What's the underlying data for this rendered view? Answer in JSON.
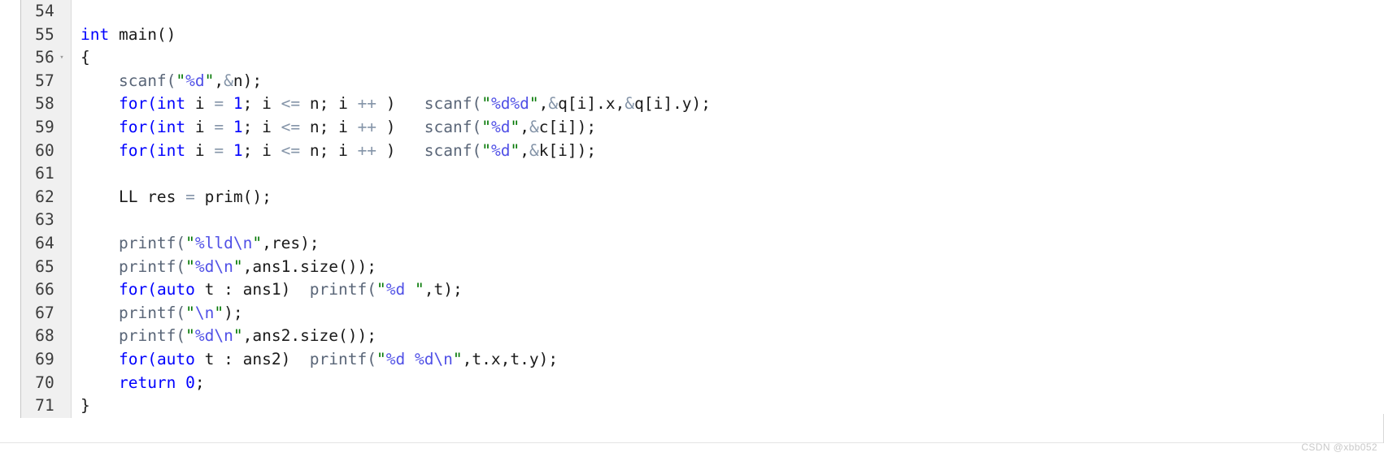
{
  "editor": {
    "language": "cpp",
    "first_line_number": 54,
    "gutter_bg": "#f0f0f0",
    "background": "#ffffff",
    "colors": {
      "keyword": "#0000ff",
      "number": "#0000ff",
      "function": "#5a6678",
      "string_quote": "#007700",
      "string_body": "#5050e6",
      "operator": "#8494a8",
      "plain": "#1a1a1a",
      "line_number": "#3c3c3c"
    }
  },
  "watermark": {
    "text": "CSDN @xbb052"
  },
  "lines": [
    {
      "number": "54",
      "fold": "",
      "tokens": []
    },
    {
      "number": "55",
      "fold": "",
      "tokens": [
        {
          "c": "t-kw",
          "s": "int"
        },
        {
          "c": "t-plain",
          "s": " main()"
        }
      ]
    },
    {
      "number": "56",
      "fold": "▾",
      "tokens": [
        {
          "c": "t-plain",
          "s": "{"
        }
      ]
    },
    {
      "number": "57",
      "fold": "",
      "tokens": [
        {
          "c": "t-plain",
          "s": "    "
        },
        {
          "c": "t-fn",
          "s": "scanf("
        },
        {
          "c": "t-quote",
          "s": "\""
        },
        {
          "c": "t-str",
          "s": "%d"
        },
        {
          "c": "t-quote",
          "s": "\""
        },
        {
          "c": "t-plain",
          "s": ","
        },
        {
          "c": "t-amp",
          "s": "&"
        },
        {
          "c": "t-plain",
          "s": "n);"
        }
      ]
    },
    {
      "number": "58",
      "fold": "",
      "tokens": [
        {
          "c": "t-plain",
          "s": "    "
        },
        {
          "c": "t-kw",
          "s": "for("
        },
        {
          "c": "t-kw",
          "s": "int"
        },
        {
          "c": "t-plain",
          "s": " i "
        },
        {
          "c": "t-op",
          "s": "="
        },
        {
          "c": "t-plain",
          "s": " "
        },
        {
          "c": "t-num",
          "s": "1"
        },
        {
          "c": "t-plain",
          "s": "; i "
        },
        {
          "c": "t-op",
          "s": "<="
        },
        {
          "c": "t-plain",
          "s": " n; i "
        },
        {
          "c": "t-op",
          "s": "++"
        },
        {
          "c": "t-plain",
          "s": " )   "
        },
        {
          "c": "t-fn",
          "s": "scanf("
        },
        {
          "c": "t-quote",
          "s": "\""
        },
        {
          "c": "t-str",
          "s": "%d%d"
        },
        {
          "c": "t-quote",
          "s": "\""
        },
        {
          "c": "t-plain",
          "s": ","
        },
        {
          "c": "t-amp",
          "s": "&"
        },
        {
          "c": "t-plain",
          "s": "q[i].x,"
        },
        {
          "c": "t-amp",
          "s": "&"
        },
        {
          "c": "t-plain",
          "s": "q[i].y);"
        }
      ]
    },
    {
      "number": "59",
      "fold": "",
      "tokens": [
        {
          "c": "t-plain",
          "s": "    "
        },
        {
          "c": "t-kw",
          "s": "for("
        },
        {
          "c": "t-kw",
          "s": "int"
        },
        {
          "c": "t-plain",
          "s": " i "
        },
        {
          "c": "t-op",
          "s": "="
        },
        {
          "c": "t-plain",
          "s": " "
        },
        {
          "c": "t-num",
          "s": "1"
        },
        {
          "c": "t-plain",
          "s": "; i "
        },
        {
          "c": "t-op",
          "s": "<="
        },
        {
          "c": "t-plain",
          "s": " n; i "
        },
        {
          "c": "t-op",
          "s": "++"
        },
        {
          "c": "t-plain",
          "s": " )   "
        },
        {
          "c": "t-fn",
          "s": "scanf("
        },
        {
          "c": "t-quote",
          "s": "\""
        },
        {
          "c": "t-str",
          "s": "%d"
        },
        {
          "c": "t-quote",
          "s": "\""
        },
        {
          "c": "t-plain",
          "s": ","
        },
        {
          "c": "t-amp",
          "s": "&"
        },
        {
          "c": "t-plain",
          "s": "c[i]);"
        }
      ]
    },
    {
      "number": "60",
      "fold": "",
      "tokens": [
        {
          "c": "t-plain",
          "s": "    "
        },
        {
          "c": "t-kw",
          "s": "for("
        },
        {
          "c": "t-kw",
          "s": "int"
        },
        {
          "c": "t-plain",
          "s": " i "
        },
        {
          "c": "t-op",
          "s": "="
        },
        {
          "c": "t-plain",
          "s": " "
        },
        {
          "c": "t-num",
          "s": "1"
        },
        {
          "c": "t-plain",
          "s": "; i "
        },
        {
          "c": "t-op",
          "s": "<="
        },
        {
          "c": "t-plain",
          "s": " n; i "
        },
        {
          "c": "t-op",
          "s": "++"
        },
        {
          "c": "t-plain",
          "s": " )   "
        },
        {
          "c": "t-fn",
          "s": "scanf("
        },
        {
          "c": "t-quote",
          "s": "\""
        },
        {
          "c": "t-str",
          "s": "%d"
        },
        {
          "c": "t-quote",
          "s": "\""
        },
        {
          "c": "t-plain",
          "s": ","
        },
        {
          "c": "t-amp",
          "s": "&"
        },
        {
          "c": "t-plain",
          "s": "k[i]);"
        }
      ]
    },
    {
      "number": "61",
      "fold": "",
      "tokens": []
    },
    {
      "number": "62",
      "fold": "",
      "tokens": [
        {
          "c": "t-plain",
          "s": "    LL res "
        },
        {
          "c": "t-op",
          "s": "="
        },
        {
          "c": "t-plain",
          "s": " prim();"
        }
      ]
    },
    {
      "number": "63",
      "fold": "",
      "tokens": []
    },
    {
      "number": "64",
      "fold": "",
      "tokens": [
        {
          "c": "t-plain",
          "s": "    "
        },
        {
          "c": "t-fn",
          "s": "printf("
        },
        {
          "c": "t-quote",
          "s": "\""
        },
        {
          "c": "t-str",
          "s": "%lld\\n"
        },
        {
          "c": "t-quote",
          "s": "\""
        },
        {
          "c": "t-plain",
          "s": ",res);"
        }
      ]
    },
    {
      "number": "65",
      "fold": "",
      "tokens": [
        {
          "c": "t-plain",
          "s": "    "
        },
        {
          "c": "t-fn",
          "s": "printf("
        },
        {
          "c": "t-quote",
          "s": "\""
        },
        {
          "c": "t-str",
          "s": "%d\\n"
        },
        {
          "c": "t-quote",
          "s": "\""
        },
        {
          "c": "t-plain",
          "s": ",ans1.size());"
        }
      ]
    },
    {
      "number": "66",
      "fold": "",
      "tokens": [
        {
          "c": "t-plain",
          "s": "    "
        },
        {
          "c": "t-kw",
          "s": "for("
        },
        {
          "c": "t-kw",
          "s": "auto"
        },
        {
          "c": "t-plain",
          "s": " t : ans1)  "
        },
        {
          "c": "t-fn",
          "s": "printf("
        },
        {
          "c": "t-quote",
          "s": "\""
        },
        {
          "c": "t-str",
          "s": "%d "
        },
        {
          "c": "t-quote",
          "s": "\""
        },
        {
          "c": "t-plain",
          "s": ",t);"
        }
      ]
    },
    {
      "number": "67",
      "fold": "",
      "tokens": [
        {
          "c": "t-plain",
          "s": "    "
        },
        {
          "c": "t-fn",
          "s": "printf("
        },
        {
          "c": "t-quote",
          "s": "\""
        },
        {
          "c": "t-str",
          "s": "\\n"
        },
        {
          "c": "t-quote",
          "s": "\""
        },
        {
          "c": "t-plain",
          "s": ");"
        }
      ]
    },
    {
      "number": "68",
      "fold": "",
      "tokens": [
        {
          "c": "t-plain",
          "s": "    "
        },
        {
          "c": "t-fn",
          "s": "printf("
        },
        {
          "c": "t-quote",
          "s": "\""
        },
        {
          "c": "t-str",
          "s": "%d\\n"
        },
        {
          "c": "t-quote",
          "s": "\""
        },
        {
          "c": "t-plain",
          "s": ",ans2.size());"
        }
      ]
    },
    {
      "number": "69",
      "fold": "",
      "tokens": [
        {
          "c": "t-plain",
          "s": "    "
        },
        {
          "c": "t-kw",
          "s": "for("
        },
        {
          "c": "t-kw",
          "s": "auto"
        },
        {
          "c": "t-plain",
          "s": " t : ans2)  "
        },
        {
          "c": "t-fn",
          "s": "printf("
        },
        {
          "c": "t-quote",
          "s": "\""
        },
        {
          "c": "t-str",
          "s": "%d %d\\n"
        },
        {
          "c": "t-quote",
          "s": "\""
        },
        {
          "c": "t-plain",
          "s": ",t.x,t.y);"
        }
      ]
    },
    {
      "number": "70",
      "fold": "",
      "tokens": [
        {
          "c": "t-plain",
          "s": "    "
        },
        {
          "c": "t-kw",
          "s": "return"
        },
        {
          "c": "t-plain",
          "s": " "
        },
        {
          "c": "t-num",
          "s": "0"
        },
        {
          "c": "t-plain",
          "s": ";"
        }
      ]
    },
    {
      "number": "71",
      "fold": "",
      "tokens": [
        {
          "c": "t-plain",
          "s": "}"
        }
      ]
    }
  ]
}
